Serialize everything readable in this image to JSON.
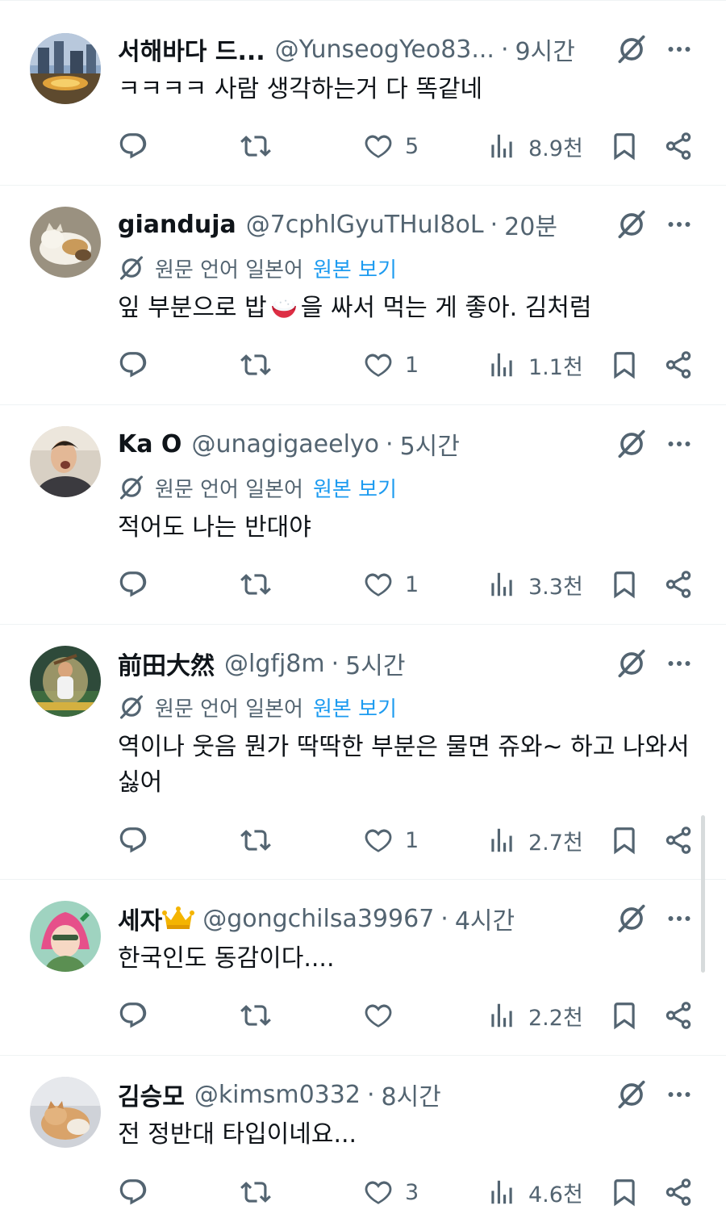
{
  "translation": {
    "label": "원문 언어 일본어",
    "link": "원본 보기"
  },
  "tweets": [
    {
      "name": "서해바다 드...",
      "handle": "@YunseogYeo83...",
      "time": "9시간",
      "text": "ㅋㅋㅋㅋ 사람 생각하는거 다 똑같네",
      "likes": "5",
      "views": "8.9천"
    },
    {
      "name": "gianduja",
      "handle": "@7cphlGyuTHuI8oL",
      "time": "20분",
      "text_before": "잎 부분으로 밥",
      "text_after": "을 싸서 먹는 게 좋아. 김처럼",
      "likes": "1",
      "views": "1.1천"
    },
    {
      "name": "Ka O",
      "handle": "@unagigaeelyo",
      "time": "5시간",
      "text": "적어도 나는 반대야",
      "likes": "1",
      "views": "3.3천"
    },
    {
      "name": "前田大然",
      "handle": "@lgfj8m",
      "time": "5시간",
      "text": "역이나 웃음 뭔가 딱딱한 부분은 물면 쥬와~ 하고 나와서 싫어",
      "likes": "1",
      "views": "2.7천"
    },
    {
      "name": "세자",
      "handle": "@gongchilsa39967",
      "time": "4시간",
      "text": "한국인도 동감이다....",
      "likes": "",
      "views": "2.2천"
    },
    {
      "name": "김승모",
      "handle": "@kimsm0332",
      "time": "8시간",
      "text": "전 정반대 타입이네요...",
      "likes": "3",
      "views": "4.6천"
    }
  ],
  "icons": {
    "reply": "reply-icon",
    "retweet": "retweet-icon",
    "like": "heart-icon",
    "views": "views-icon",
    "bookmark": "bookmark-icon",
    "share": "share-icon",
    "grok": "grok-icon",
    "more": "more-icon"
  },
  "colors": {
    "text": "#0f1419",
    "secondary": "#536471",
    "link": "#1d9bf0",
    "divider": "#eff3f4"
  }
}
